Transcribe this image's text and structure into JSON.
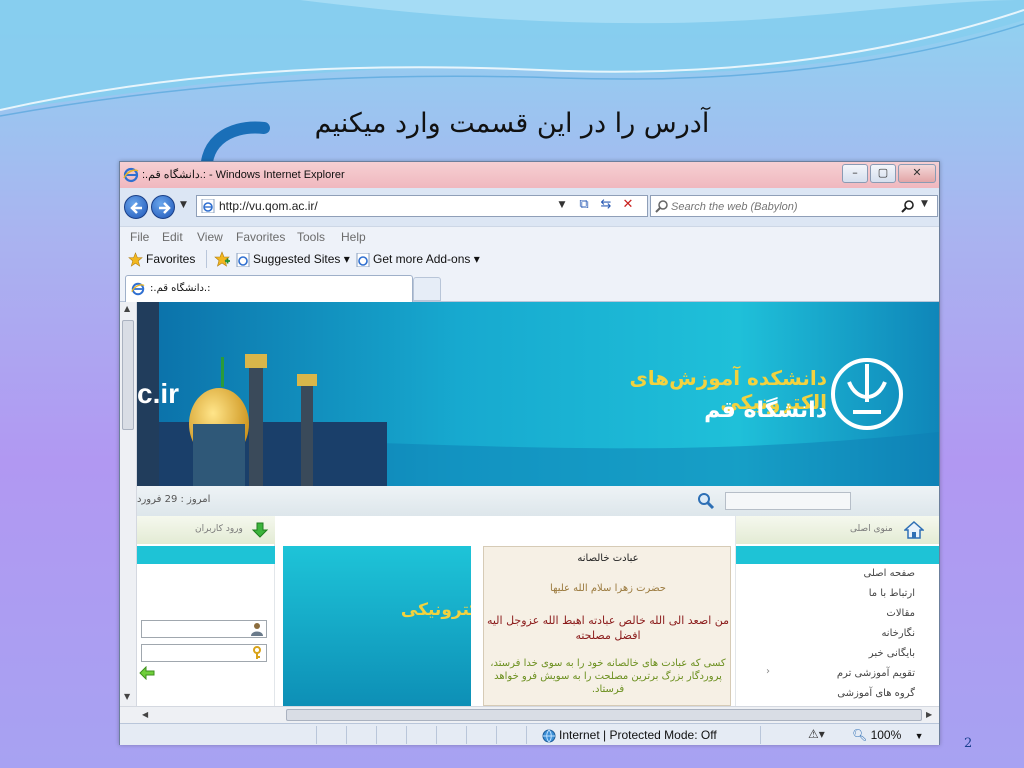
{
  "slide": {
    "title": "آدرس را در این قسمت وارد میکنیم",
    "page_number": "2"
  },
  "browser": {
    "window_title": ":.دانشگاه قم.: - Windows Internet Explorer",
    "window_controls": {
      "minimize": "–",
      "maximize": "▢",
      "close": "✕"
    },
    "address": {
      "value": "http://vu.qom.ac.ir/"
    },
    "search": {
      "placeholder": "Search the web (Babylon)"
    },
    "menu": [
      "File",
      "Edit",
      "View",
      "Favorites",
      "Tools",
      "Help"
    ],
    "favorites_bar": {
      "favorites": "Favorites",
      "suggested_sites": "Suggested Sites ▾",
      "addons": "Get more Add-ons ▾"
    },
    "tab": {
      "label": ":.دانشگاه قم.:"
    },
    "status": {
      "zone": "Internet | Protected Mode: Off",
      "zoom": "100%"
    },
    "icons": {
      "back": "back-arrow-icon",
      "forward": "forward-arrow-icon",
      "refresh": "refresh-icon",
      "stop": "stop-icon",
      "search": "magnifier-icon",
      "ie": "ie-logo-icon"
    }
  },
  "site": {
    "banner": {
      "domain_fragment": "c.ir",
      "title": "دانشکده آموزش‌های الکترونیکی",
      "subtitle": "دانشگاه قم"
    },
    "date_text": "امروز : 29 فرورد",
    "login_panel": {
      "heading": "ورود کاربران"
    },
    "main_menu": {
      "heading": "منوی اصلی",
      "items": [
        "صفحه اصلی",
        "ارتباط با ما",
        "مقالات",
        "نگارخانه",
        "بایگانی خبر",
        "تقویم آموزشی ترم",
        "گروه های آموزشی"
      ]
    },
    "ad_text": "ی الکترونیکی",
    "quote": {
      "title": "عبادت خالصانه",
      "attribution": "حضرت زهرا سلام الله علیها",
      "arabic": "من اصعد الی الله خالص عبادته اهبط الله عزوجل الیه افضل مصلحته",
      "persian": "کسی که عبادت های خالصانه خود را به سوی خدا فرستد، پروردگار بزرگ برترین مصلحت را به سویش فرو خواهد فرستاد."
    }
  },
  "colors": {
    "teal": "#1ec3d6",
    "gold": "#f2d23f",
    "titlebar_pink": "#f0b8bf"
  }
}
